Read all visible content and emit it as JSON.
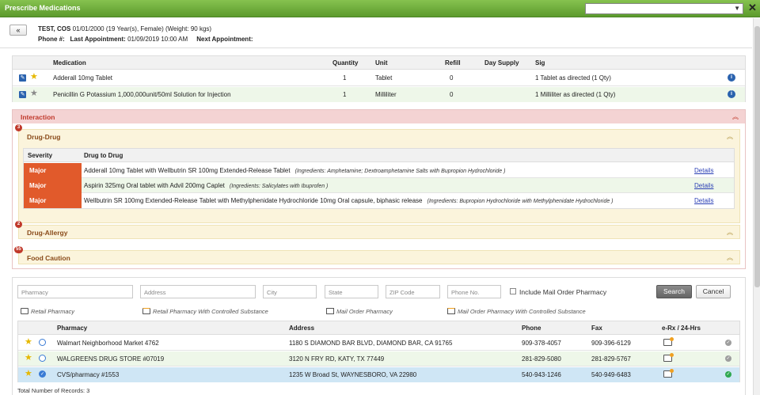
{
  "window": {
    "title": "Prescribe Medications"
  },
  "patient": {
    "name": "TEST, COS",
    "details": "01/01/2000 (19 Year(s), Female) (Weight: 90 kgs)",
    "phone_label": "Phone #:",
    "phone_value": "",
    "last_appt_label": "Last Appointment:",
    "last_appt_value": "01/09/2019 10:00 AM",
    "next_appt_label": "Next Appointment:",
    "next_appt_value": ""
  },
  "medications": {
    "headers": [
      "Medication",
      "Quantity",
      "Unit",
      "Refill",
      "Day Supply",
      "Sig"
    ],
    "rows": [
      {
        "medication": "Adderall 10mg Tablet",
        "quantity": "1",
        "unit": "Tablet",
        "refill": "0",
        "day_supply": "",
        "sig": "1 Tablet as directed (1 Qty)",
        "favorite": true
      },
      {
        "medication": "Penicillin G Potassium 1,000,000unit/50ml Solution for Injection",
        "quantity": "1",
        "unit": "Milliliter",
        "refill": "0",
        "day_supply": "",
        "sig": "1 Milliliter as directed (1 Qty)",
        "favorite": false
      }
    ]
  },
  "interaction": {
    "title": "Interaction",
    "drug_drug": {
      "title": "Drug-Drug",
      "count": "3",
      "headers": [
        "Severity",
        "Drug to Drug"
      ],
      "rows": [
        {
          "severity": "Major",
          "drugs": "Adderall 10mg Tablet with Wellbutrin SR 100mg Extended-Release Tablet",
          "ingredients": "(Ingredients: Amphetamine; Dextroamphetamine Salts with Bupropion Hydrochloride )",
          "link": "Details"
        },
        {
          "severity": "Major",
          "drugs": "Aspirin 325mg Oral tablet with Advil 200mg Caplet",
          "ingredients": "(Ingredients: Salicylates with Ibuprofen )",
          "link": "Details"
        },
        {
          "severity": "Major",
          "drugs": "Wellbutrin SR 100mg Extended-Release Tablet with Methylphenidate Hydrochloride 10mg Oral capsule, biphasic release",
          "ingredients": "(Ingredients: Bupropion Hydrochloride with Methylphenidate Hydrochloride )",
          "link": "Details"
        }
      ]
    },
    "drug_allergy": {
      "title": "Drug-Allergy",
      "count": "2"
    },
    "food_caution": {
      "title": "Food Caution",
      "count": "55"
    }
  },
  "pharmacy_search": {
    "placeholders": {
      "pharmacy": "Pharmacy",
      "address": "Address",
      "city": "City",
      "state": "State",
      "zip": "ZIP Code",
      "phone": "Phone No."
    },
    "include_mail_order": "Include Mail Order Pharmacy",
    "search_button": "Search",
    "cancel_button": "Cancel",
    "legend": {
      "retail": "Retail Pharmacy",
      "retail_controlled": "Retail Pharmacy With Controlled Substance",
      "mail_order": "Mail Order Pharmacy",
      "mail_order_controlled": "Mail Order Pharmacy With Controlled Substance"
    }
  },
  "pharmacies": {
    "headers": [
      "Pharmacy",
      "Address",
      "Phone",
      "Fax",
      "e-Rx / 24-Hrs"
    ],
    "rows": [
      {
        "name": "Walmart Neighborhood Market 4762",
        "address": "1180 S DIAMOND BAR BLVD, DIAMOND BAR, CA 91765",
        "phone": "909-378-4057",
        "fax": "909-396-6129",
        "selected": false
      },
      {
        "name": "WALGREENS DRUG STORE #07019",
        "address": "3120 N FRY RD, KATY, TX 77449",
        "phone": "281-829-5080",
        "fax": "281-829-5767",
        "selected": false
      },
      {
        "name": "CVS/pharmacy #1553",
        "address": "1235 W Broad St, WAYNESBORO, VA 22980",
        "phone": "540-943-1246",
        "fax": "540-949-6483",
        "selected": true
      }
    ],
    "total_label": "Total Number of Records: 3"
  }
}
